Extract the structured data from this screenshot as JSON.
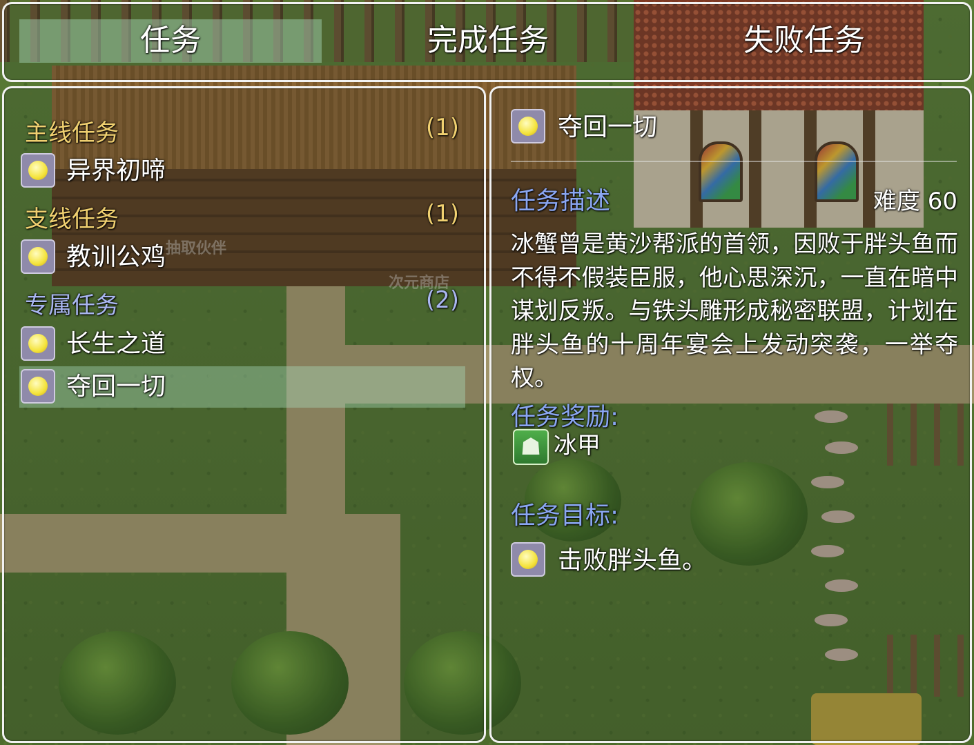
{
  "tabs": [
    {
      "label": "任务",
      "active": true
    },
    {
      "label": "完成任务",
      "active": false
    },
    {
      "label": "失败任务",
      "active": false
    }
  ],
  "quest_list": {
    "categories": [
      {
        "label": "主线任务",
        "count": "(1)",
        "color": "#f0d070",
        "items": [
          "异界初啼"
        ]
      },
      {
        "label": "支线任务",
        "count": "(1)",
        "color": "#f0d070",
        "items": [
          "教训公鸡"
        ]
      },
      {
        "label": "专属任务",
        "count": "(2)",
        "color": "#a9b6f0",
        "items": [
          "长生之道",
          "夺回一切"
        ]
      }
    ],
    "selected": "夺回一切"
  },
  "detail": {
    "title": "夺回一切",
    "description_label": "任务描述",
    "difficulty": "难度 60",
    "description": "冰蟹曾是黄沙帮派的首领，因败于胖头鱼而不得不假装臣服，他心思深沉，一直在暗中谋划反叛。与铁头雕形成秘密联盟，计划在胖头鱼的十周年宴会上发动突袭，一举夺权。",
    "reward_label": "任务奖励:",
    "reward_item": "冰甲",
    "objective_label": "任务目标:",
    "objective": "击败胖头鱼。"
  },
  "map_labels": {
    "gacha": "抽取伙伴",
    "shop": "次元商店"
  },
  "colors": {
    "category_main": "#f0d070",
    "category_exclusive": "#a9b6f0",
    "section_heading": "#8aa6f2",
    "window_border": "#f2f2f2",
    "selection": "#aadcbe"
  },
  "icons": {
    "quest": "yellow-orb-icon",
    "reward": "armor-icon"
  }
}
